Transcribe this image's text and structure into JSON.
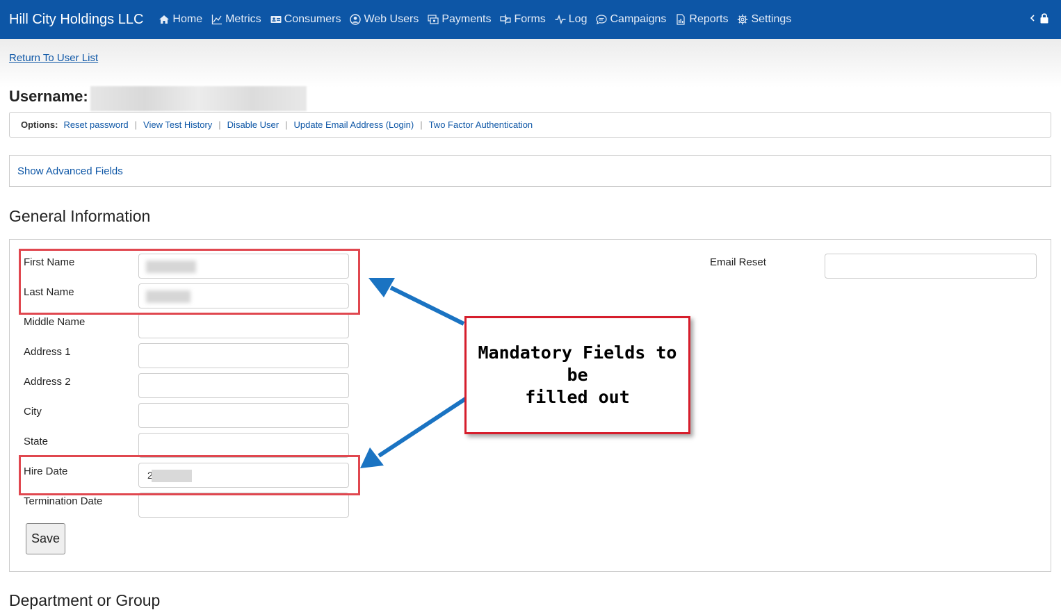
{
  "nav": {
    "brand": "Hill City Holdings LLC",
    "items": [
      {
        "label": "Home",
        "icon": "home-icon"
      },
      {
        "label": "Metrics",
        "icon": "chart-line-icon"
      },
      {
        "label": "Consumers",
        "icon": "id-card-icon"
      },
      {
        "label": "Web Users",
        "icon": "user-circle-icon"
      },
      {
        "label": "Payments",
        "icon": "payment-icon"
      },
      {
        "label": "Forms",
        "icon": "forms-icon"
      },
      {
        "label": "Log",
        "icon": "pulse-icon"
      },
      {
        "label": "Campaigns",
        "icon": "chat-bubble-icon"
      },
      {
        "label": "Reports",
        "icon": "report-icon"
      },
      {
        "label": "Settings",
        "icon": "gear-icon"
      }
    ],
    "right_icons": [
      "chevron-left-icon",
      "lock-icon"
    ],
    "color": "#0d56a6"
  },
  "return_link": "Return To User List",
  "username_label": "Username:",
  "options": {
    "label": "Options:",
    "links": [
      "Reset password",
      "View Test History",
      "Disable User",
      "Update Email Address (Login)",
      "Two Factor Authentication"
    ]
  },
  "advanced_link": "Show Advanced Fields",
  "general": {
    "title": "General Information",
    "fields": [
      {
        "label": "First Name",
        "value": ""
      },
      {
        "label": "Last Name",
        "value": ""
      },
      {
        "label": "Middle Name",
        "value": ""
      },
      {
        "label": "Address 1",
        "value": ""
      },
      {
        "label": "Address 2",
        "value": ""
      },
      {
        "label": "City",
        "value": ""
      },
      {
        "label": "State",
        "value": ""
      },
      {
        "label": "Hire Date",
        "value": "2"
      },
      {
        "label": "Termination Date",
        "value": ""
      }
    ],
    "email_reset_label": "Email Reset",
    "save_label": "Save"
  },
  "annotation": {
    "callout_line1": "Mandatory Fields to be",
    "callout_line2": "filled out",
    "highlight_color": "#e0474f",
    "arrow_color": "#1a73c2"
  },
  "department_title": "Department or Group"
}
